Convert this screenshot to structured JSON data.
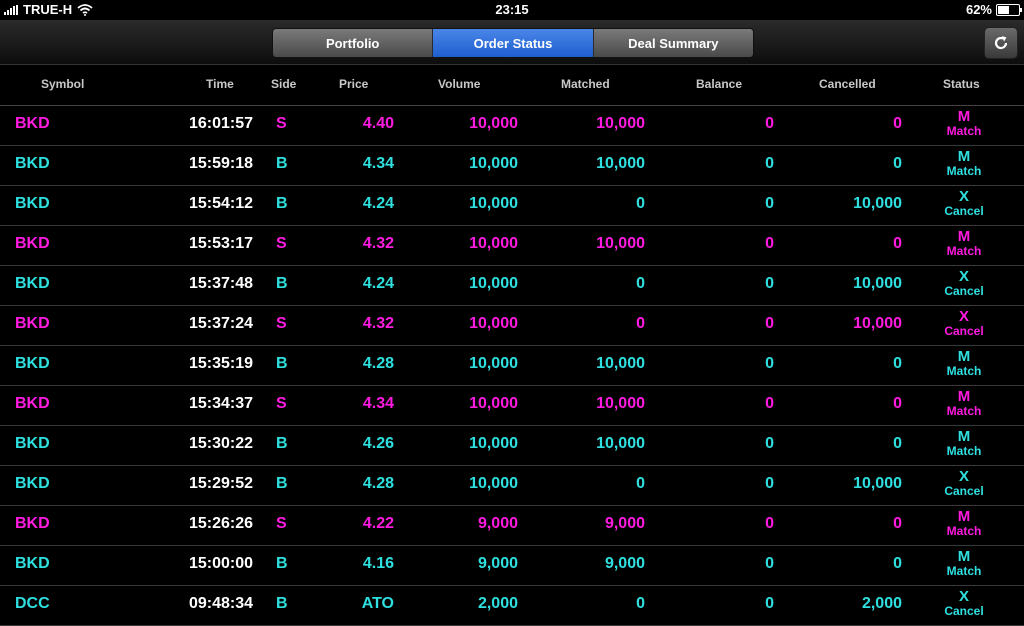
{
  "status_bar": {
    "carrier": "TRUE-H",
    "time": "23:15",
    "battery": "62%",
    "battery_level": 0.62
  },
  "tabs": [
    {
      "label": "Portfolio",
      "active": false
    },
    {
      "label": "Order Status",
      "active": true
    },
    {
      "label": "Deal Summary",
      "active": false
    }
  ],
  "refresh_icon": "refresh-icon",
  "columns": {
    "symbol": "Symbol",
    "time": "Time",
    "side": "Side",
    "price": "Price",
    "volume": "Volume",
    "matched": "Matched",
    "balance": "Balance",
    "cancelled": "Cancelled",
    "status": "Status"
  },
  "colors": {
    "sell": "#ff1ae0",
    "buy": "#2ee0e0",
    "active_tab": "#2f6fe0"
  },
  "orders": [
    {
      "symbol": "BKD",
      "time": "16:01:57",
      "side": "S",
      "price": "4.40",
      "volume": "10,000",
      "matched": "10,000",
      "balance": "0",
      "cancelled": "0",
      "status_code": "M",
      "status_text": "Match"
    },
    {
      "symbol": "BKD",
      "time": "15:59:18",
      "side": "B",
      "price": "4.34",
      "volume": "10,000",
      "matched": "10,000",
      "balance": "0",
      "cancelled": "0",
      "status_code": "M",
      "status_text": "Match"
    },
    {
      "symbol": "BKD",
      "time": "15:54:12",
      "side": "B",
      "price": "4.24",
      "volume": "10,000",
      "matched": "0",
      "balance": "0",
      "cancelled": "10,000",
      "status_code": "X",
      "status_text": "Cancel"
    },
    {
      "symbol": "BKD",
      "time": "15:53:17",
      "side": "S",
      "price": "4.32",
      "volume": "10,000",
      "matched": "10,000",
      "balance": "0",
      "cancelled": "0",
      "status_code": "M",
      "status_text": "Match"
    },
    {
      "symbol": "BKD",
      "time": "15:37:48",
      "side": "B",
      "price": "4.24",
      "volume": "10,000",
      "matched": "0",
      "balance": "0",
      "cancelled": "10,000",
      "status_code": "X",
      "status_text": "Cancel"
    },
    {
      "symbol": "BKD",
      "time": "15:37:24",
      "side": "S",
      "price": "4.32",
      "volume": "10,000",
      "matched": "0",
      "balance": "0",
      "cancelled": "10,000",
      "status_code": "X",
      "status_text": "Cancel"
    },
    {
      "symbol": "BKD",
      "time": "15:35:19",
      "side": "B",
      "price": "4.28",
      "volume": "10,000",
      "matched": "10,000",
      "balance": "0",
      "cancelled": "0",
      "status_code": "M",
      "status_text": "Match"
    },
    {
      "symbol": "BKD",
      "time": "15:34:37",
      "side": "S",
      "price": "4.34",
      "volume": "10,000",
      "matched": "10,000",
      "balance": "0",
      "cancelled": "0",
      "status_code": "M",
      "status_text": "Match"
    },
    {
      "symbol": "BKD",
      "time": "15:30:22",
      "side": "B",
      "price": "4.26",
      "volume": "10,000",
      "matched": "10,000",
      "balance": "0",
      "cancelled": "0",
      "status_code": "M",
      "status_text": "Match"
    },
    {
      "symbol": "BKD",
      "time": "15:29:52",
      "side": "B",
      "price": "4.28",
      "volume": "10,000",
      "matched": "0",
      "balance": "0",
      "cancelled": "10,000",
      "status_code": "X",
      "status_text": "Cancel"
    },
    {
      "symbol": "BKD",
      "time": "15:26:26",
      "side": "S",
      "price": "4.22",
      "volume": "9,000",
      "matched": "9,000",
      "balance": "0",
      "cancelled": "0",
      "status_code": "M",
      "status_text": "Match"
    },
    {
      "symbol": "BKD",
      "time": "15:00:00",
      "side": "B",
      "price": "4.16",
      "volume": "9,000",
      "matched": "9,000",
      "balance": "0",
      "cancelled": "0",
      "status_code": "M",
      "status_text": "Match"
    },
    {
      "symbol": "DCC",
      "time": "09:48:34",
      "side": "B",
      "price": "ATO",
      "volume": "2,000",
      "matched": "0",
      "balance": "0",
      "cancelled": "2,000",
      "status_code": "X",
      "status_text": "Cancel"
    }
  ]
}
